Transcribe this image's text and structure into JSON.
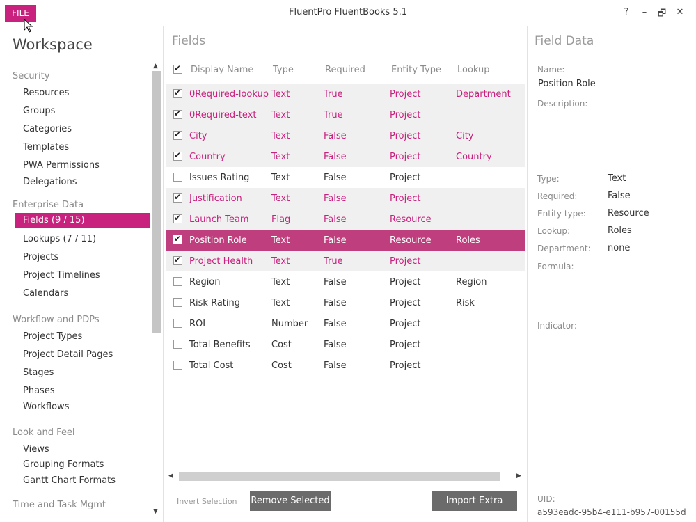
{
  "titlebar": {
    "file_label": "FILE",
    "title": "FluentPro FluentBooks 5.1",
    "help": "?",
    "minimize": "–",
    "restore": "🗗",
    "close": "✕"
  },
  "sidebar": {
    "title": "Workspace",
    "sections": [
      {
        "label": "Security",
        "items": [
          "Resources",
          "Groups",
          "Categories",
          "Templates",
          "PWA Permissions",
          "Delegations"
        ]
      },
      {
        "label": "Enterprise Data",
        "items": [
          "Fields (9 / 15)",
          "Lookups (7 / 11)",
          "Projects",
          "Project Timelines",
          "Calendars"
        ]
      },
      {
        "label": "Workflow and PDPs",
        "items": [
          "Project Types",
          "Project Detail Pages",
          "Stages",
          "Phases",
          "Workflows"
        ]
      },
      {
        "label": "Look and Feel",
        "items": [
          "Views",
          "Grouping Formats",
          "Gantt Chart Formats"
        ]
      },
      {
        "label": "Time and Task Mgmt",
        "items": []
      }
    ],
    "active_item": "Fields (9 / 15)"
  },
  "fields": {
    "title": "Fields",
    "columns": [
      "Display Name",
      "Type",
      "Required",
      "Entity Type",
      "Lookup"
    ],
    "header_checked": true,
    "rows": [
      {
        "name": "0Required-lookup",
        "type": "Text",
        "required": "True",
        "entity": "Project",
        "lookup": "Department",
        "checked": true
      },
      {
        "name": "0Required-text",
        "type": "Text",
        "required": "True",
        "entity": "Project",
        "lookup": "",
        "checked": true
      },
      {
        "name": "City",
        "type": "Text",
        "required": "False",
        "entity": "Project",
        "lookup": "City",
        "checked": true
      },
      {
        "name": "Country",
        "type": "Text",
        "required": "False",
        "entity": "Project",
        "lookup": "Country",
        "checked": true
      },
      {
        "name": "Issues Rating",
        "type": "Text",
        "required": "False",
        "entity": "Project",
        "lookup": "",
        "checked": false
      },
      {
        "name": "Justification",
        "type": "Text",
        "required": "False",
        "entity": "Project",
        "lookup": "",
        "checked": true
      },
      {
        "name": "Launch Team",
        "type": "Flag",
        "required": "False",
        "entity": "Resource",
        "lookup": "",
        "checked": true
      },
      {
        "name": "Position Role",
        "type": "Text",
        "required": "False",
        "entity": "Resource",
        "lookup": "Roles",
        "checked": true,
        "selected": true
      },
      {
        "name": "Project Health",
        "type": "Text",
        "required": "True",
        "entity": "Project",
        "lookup": "",
        "checked": true
      },
      {
        "name": "Region",
        "type": "Text",
        "required": "False",
        "entity": "Project",
        "lookup": "Region",
        "checked": false
      },
      {
        "name": "Risk Rating",
        "type": "Text",
        "required": "False",
        "entity": "Project",
        "lookup": "Risk",
        "checked": false
      },
      {
        "name": "ROI",
        "type": "Number",
        "required": "False",
        "entity": "Project",
        "lookup": "",
        "checked": false
      },
      {
        "name": "Total Benefits",
        "type": "Cost",
        "required": "False",
        "entity": "Project",
        "lookup": "",
        "checked": false
      },
      {
        "name": "Total Cost",
        "type": "Cost",
        "required": "False",
        "entity": "Project",
        "lookup": "",
        "checked": false
      }
    ],
    "invert_selection": "Invert Selection",
    "remove_selected": "Remove Selected",
    "import_extra": "Import Extra"
  },
  "field_data": {
    "title": "Field Data",
    "name_label": "Name:",
    "name_value": "Position Role",
    "description_label": "Description:",
    "type_label": "Type:",
    "type_value": "Text",
    "required_label": "Required:",
    "required_value": "False",
    "entity_label": "Entity type:",
    "entity_value": "Resource",
    "lookup_label": "Lookup:",
    "lookup_value": "Roles",
    "department_label": "Department:",
    "department_value": "none",
    "formula_label": "Formula:",
    "indicator_label": "Indicator:",
    "uid_label": "UID:",
    "uid_value": "a593eadc-95b4-e111-b957-00155d"
  },
  "colors": {
    "accent": "#c8217e",
    "selected_row": "#bf3e7d",
    "button_dark": "#6b6b6b"
  }
}
